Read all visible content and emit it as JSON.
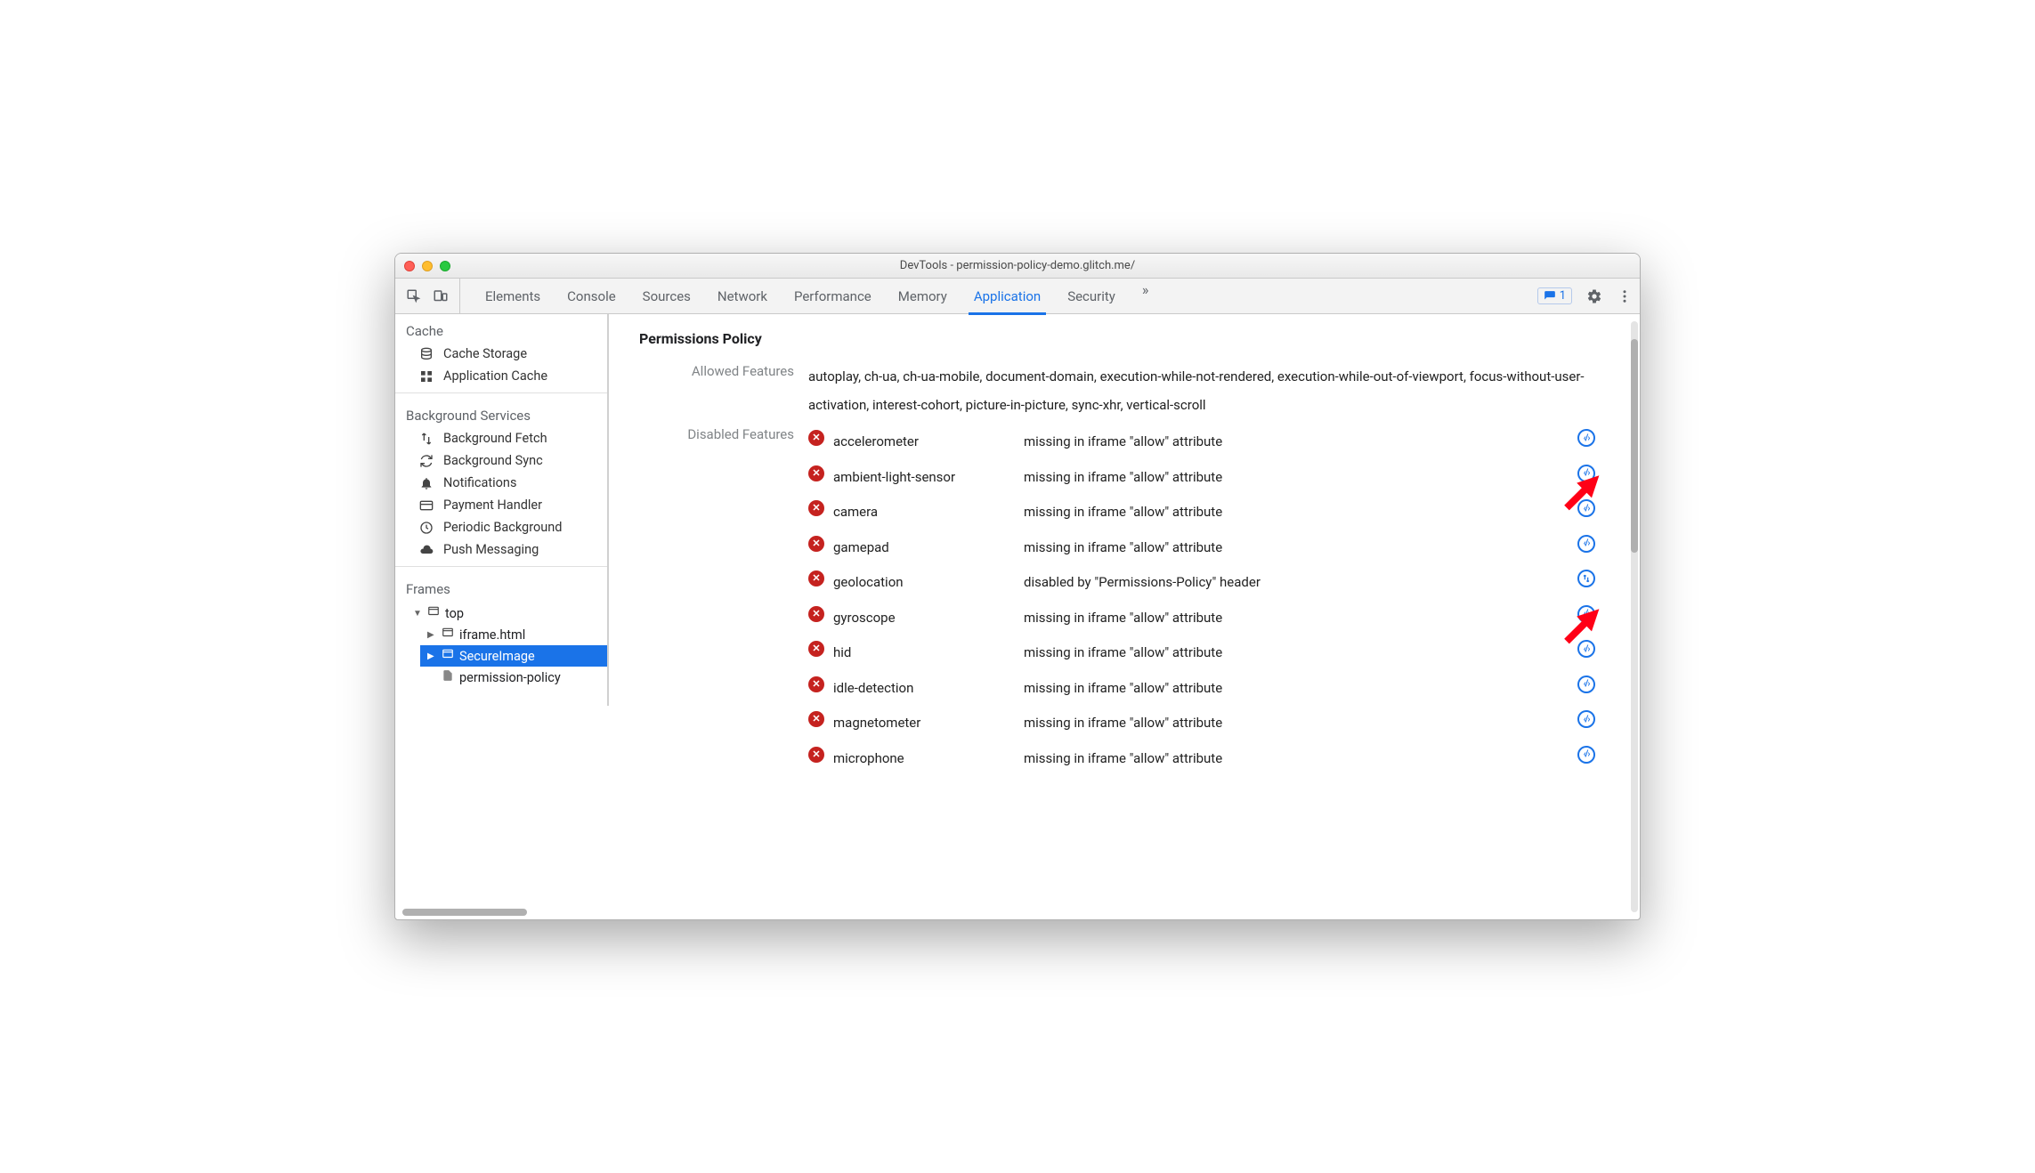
{
  "window": {
    "title": "DevTools - permission-policy-demo.glitch.me/"
  },
  "toolbar": {
    "tabs": [
      "Elements",
      "Console",
      "Sources",
      "Network",
      "Performance",
      "Memory",
      "Application",
      "Security"
    ],
    "active_tab": "Application",
    "overflow_glyph": "»",
    "issues_count": "1"
  },
  "sidebar": {
    "sections": [
      {
        "title": "Cache",
        "items": [
          {
            "icon": "database-icon",
            "label": "Cache Storage"
          },
          {
            "icon": "grid-icon",
            "label": "Application Cache"
          }
        ]
      },
      {
        "title": "Background Services",
        "items": [
          {
            "icon": "updown-icon",
            "label": "Background Fetch"
          },
          {
            "icon": "sync-icon",
            "label": "Background Sync"
          },
          {
            "icon": "bell-icon",
            "label": "Notifications"
          },
          {
            "icon": "card-icon",
            "label": "Payment Handler"
          },
          {
            "icon": "clock-icon",
            "label": "Periodic Background"
          },
          {
            "icon": "cloud-icon",
            "label": "Push Messaging"
          }
        ]
      },
      {
        "title": "Frames",
        "tree": true
      }
    ],
    "frames_tree": {
      "root": {
        "label": "top",
        "icon": "window-icon"
      },
      "children": [
        {
          "label": "iframe.html",
          "icon": "frame-icon"
        },
        {
          "label": "SecureImage",
          "icon": "frame-icon",
          "selected": true
        },
        {
          "label": "permission-policy",
          "icon": "file-icon"
        }
      ]
    }
  },
  "main": {
    "heading": "Permissions Policy",
    "allowed_label": "Allowed Features",
    "allowed_text": "autoplay, ch-ua, ch-ua-mobile, document-domain, execution-while-not-rendered, execution-while-out-of-viewport, focus-without-user-activation, interest-cohort, picture-in-picture, sync-xhr, vertical-scroll",
    "disabled_label": "Disabled Features",
    "disabled": [
      {
        "name": "accelerometer",
        "reason": "missing in iframe \"allow\" attribute",
        "link": "code"
      },
      {
        "name": "ambient-light-sensor",
        "reason": "missing in iframe \"allow\" attribute",
        "link": "code"
      },
      {
        "name": "camera",
        "reason": "missing in iframe \"allow\" attribute",
        "link": "code"
      },
      {
        "name": "gamepad",
        "reason": "missing in iframe \"allow\" attribute",
        "link": "code"
      },
      {
        "name": "geolocation",
        "reason": "disabled by \"Permissions-Policy\" header",
        "link": "net"
      },
      {
        "name": "gyroscope",
        "reason": "missing in iframe \"allow\" attribute",
        "link": "code"
      },
      {
        "name": "hid",
        "reason": "missing in iframe \"allow\" attribute",
        "link": "code"
      },
      {
        "name": "idle-detection",
        "reason": "missing in iframe \"allow\" attribute",
        "link": "code"
      },
      {
        "name": "magnetometer",
        "reason": "missing in iframe \"allow\" attribute",
        "link": "code"
      },
      {
        "name": "microphone",
        "reason": "missing in iframe \"allow\" attribute",
        "link": "code"
      }
    ]
  }
}
